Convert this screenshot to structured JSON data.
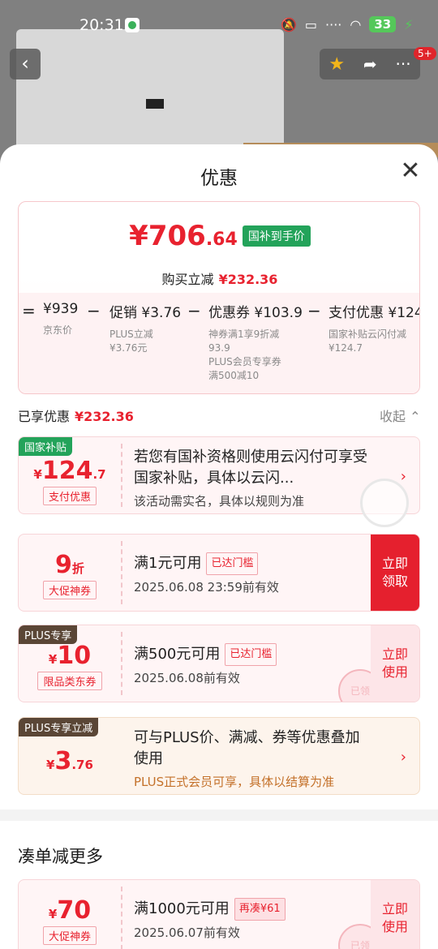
{
  "status_bar": {
    "time": "20:31",
    "battery": "33"
  },
  "header": {
    "cart_badge": "5+"
  },
  "sheet": {
    "title": "优惠"
  },
  "summary": {
    "price_symbol": "¥",
    "price_int": "706",
    "price_dec": ".64",
    "price_tag": "国补到手价",
    "reduce_label": "购买立减",
    "reduce_value": "¥232.36",
    "formula": {
      "op_eq": "=",
      "base_main": "¥939",
      "base_sub": "京东价",
      "op1": "−",
      "promo_main": "促销 ¥3.76",
      "promo_sub": "PLUS立减\n¥3.76元",
      "op2": "−",
      "coupon_main": "优惠券 ¥103.9",
      "coupon_sub": "神券满1享9折减\n93.9\nPLUS会员专享券\n满500减10",
      "op3": "−",
      "pay_main": "支付优惠 ¥124",
      "pay_sub": "国家补贴云闪付减\n¥124.7"
    }
  },
  "enjoyed": {
    "label": "已享优惠",
    "value": "¥232.36",
    "collapse": "收起"
  },
  "cards": [
    {
      "ribbon": "国家补贴",
      "amount_symbol": "¥",
      "amount_int": "124",
      "amount_dec": ".7",
      "label": "支付优惠",
      "title": "若您有国补资格则使用云闪付可享受国家补贴，具体以云闪...",
      "desc": "该活动需实名，具体以规则为准"
    },
    {
      "amount_int": "9",
      "amount_unit": "折",
      "label": "大促神券",
      "title": "满1元可用",
      "badge": "已达门槛",
      "desc": "2025.06.08  23:59前有效",
      "action": "立即\n领取"
    },
    {
      "ribbon": "PLUS专享",
      "amount_symbol": "¥",
      "amount_int": "10",
      "label": "限品类东券",
      "title": "满500元可用",
      "badge": "已达门槛",
      "desc": "2025.06.08前有效",
      "action": "立即\n使用",
      "stamp": "已领"
    },
    {
      "ribbon": "PLUS专享立减",
      "amount_symbol": "¥",
      "amount_int": "3",
      "amount_dec": ".76",
      "title": "可与PLUS价、满减、券等优惠叠加使用",
      "desc": "PLUS正式会员可享，具体以结算为准"
    }
  ],
  "more_section": {
    "title": "凑单减更多",
    "card": {
      "amount_symbol": "¥",
      "amount_int": "70",
      "label": "大促神券",
      "title": "满1000元可用",
      "badge": "再凑¥61",
      "desc": "2025.06.07前有效",
      "action": "立即\n使用",
      "stamp": "已领"
    }
  },
  "colors": {
    "accent": "#e8222f",
    "green_tag": "#23a35a",
    "plus_brown": "#5a4636"
  }
}
